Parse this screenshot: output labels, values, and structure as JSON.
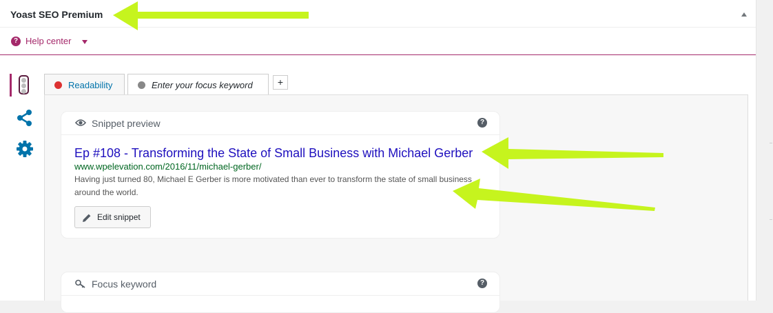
{
  "metabox": {
    "title": "Yoast SEO Premium",
    "collapse_icon": "triangle-up-icon"
  },
  "help": {
    "label": "Help center",
    "icon": "question-circle-icon",
    "caret_icon": "caret-down-icon"
  },
  "side_nav": {
    "items": [
      {
        "name": "content-analysis",
        "icon": "traffic-light-icon"
      },
      {
        "name": "social",
        "icon": "share-icon"
      },
      {
        "name": "advanced",
        "icon": "gear-icon"
      }
    ]
  },
  "tabs": [
    {
      "label": "Readability",
      "status_color": "#dc3232"
    },
    {
      "label": "Enter your focus keyword",
      "status_color": "#888888"
    }
  ],
  "add_tab_label": "+",
  "snippet": {
    "heading": "Snippet preview",
    "title": "Ep #108 - Transforming the State of Small Business with Michael Gerber",
    "url": "www.wpelevation.com/2016/11/michael-gerber/",
    "description": "Having just turned 80, Michael E Gerber is more motivated than ever to transform the state of small business around the world.",
    "edit_label": "Edit snippet"
  },
  "focus_keyword": {
    "heading": "Focus keyword"
  },
  "colors": {
    "brand": "#a4286a",
    "link": "#0073aa",
    "snippet_title": "#1e0fbe",
    "snippet_url": "#006621",
    "annotation_arrow": "#c6f41e"
  }
}
